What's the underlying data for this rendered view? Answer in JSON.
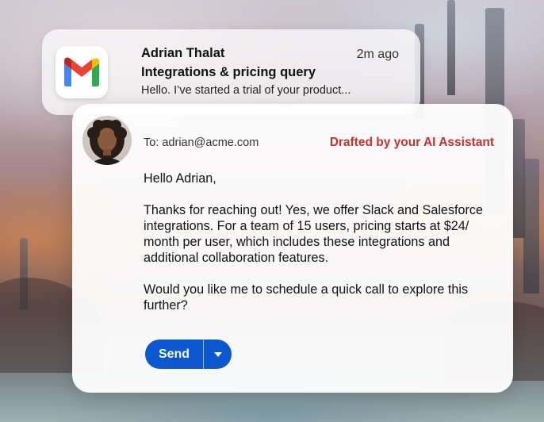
{
  "notification": {
    "app_icon": "gmail-icon",
    "sender": "Adrian Thalat",
    "time": "2m ago",
    "subject": "Integrations & pricing query",
    "preview": "Hello. I’ve started a trial of your  product..."
  },
  "draft": {
    "avatar": "avatar",
    "to": "To: adrian@acme.com",
    "badge": "Drafted by your AI Assistant",
    "badge_color": "#c9302c",
    "greeting": "Hello Adrian,",
    "paragraph1": "Thanks for reaching out! Yes, we offer Slack and Salesforce integrations. For a team of 15 users, pricing starts at $24/ month per user, which includes these integrations and additional collaboration features.",
    "paragraph2": "Would you like me to schedule a quick call to explore this further?",
    "send_label": "Send",
    "send_more_icon": "caret-down-icon",
    "accent": "#0b57d0"
  }
}
